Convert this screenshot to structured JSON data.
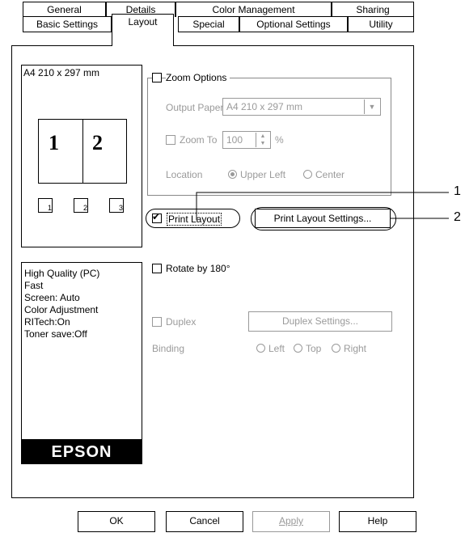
{
  "tabs_row1": [
    "General",
    "Details",
    "Color Management",
    "Sharing"
  ],
  "tabs_row2": [
    "Basic Settings",
    "Layout",
    "Special",
    "Optional Settings",
    "Utility"
  ],
  "preview": {
    "paper_label": "A4 210 x 297 mm",
    "page1": "1",
    "page2": "2",
    "order_icons": [
      "1",
      "2",
      "3"
    ]
  },
  "zoom": {
    "checkbox_label": "Zoom Options",
    "output_paper_label": "Output Paper",
    "output_paper_value": "A4 210 x 297 mm",
    "zoom_to_label": "Zoom To",
    "zoom_to_value": "100",
    "zoom_unit": "%",
    "location_label": "Location",
    "upper_left_label": "Upper Left",
    "center_label": "Center"
  },
  "print_layout": {
    "checkbox_label": "Print Layout",
    "checked": true,
    "settings_button": "Print Layout Settings..."
  },
  "rotate": {
    "label": "Rotate by 180°"
  },
  "duplex": {
    "label": "Duplex",
    "settings_button": "Duplex Settings...",
    "binding_label": "Binding",
    "left": "Left",
    "top": "Top",
    "right": "Right"
  },
  "info_lines": [
    "High Quality (PC)",
    "Fast",
    "Screen: Auto",
    "Color Adjustment",
    "RITech:On",
    "Toner save:Off"
  ],
  "brand": "EPSON",
  "buttons": {
    "ok": "OK",
    "cancel": "Cancel",
    "apply": "Apply",
    "help": "Help"
  },
  "callouts": {
    "one": "1",
    "two": "2"
  }
}
